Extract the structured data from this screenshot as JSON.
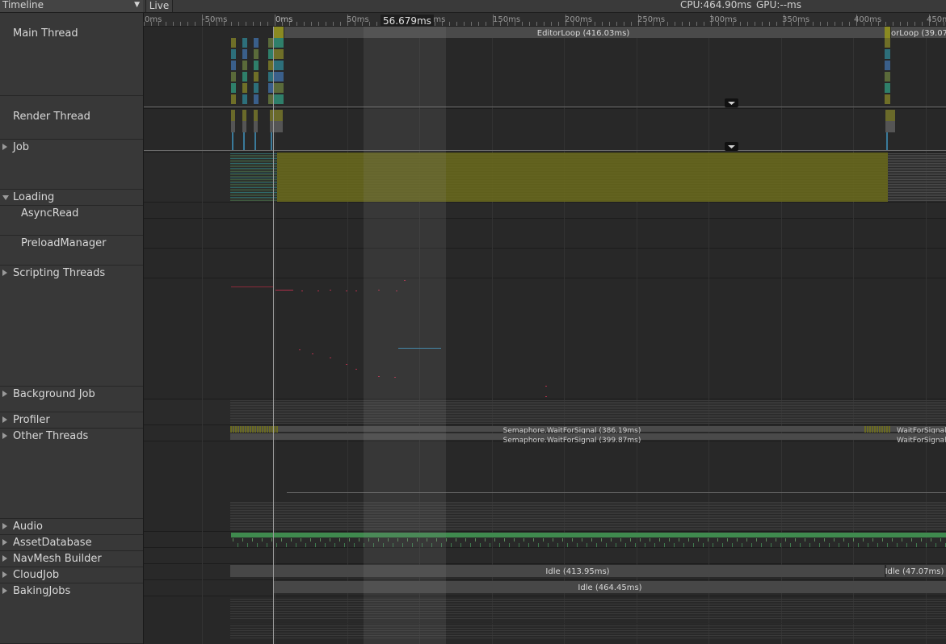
{
  "toolbar": {
    "view_mode": "Timeline",
    "live_label": "Live",
    "cpu_text": "CPU:464.90ms",
    "gpu_text": "GPU:--ms"
  },
  "selection": {
    "duration_label": "56.679ms"
  },
  "ruler": {
    "tick_labels": [
      "0ms",
      "-50ms",
      "0ms",
      "50ms",
      "0ms",
      "150ms",
      "200ms",
      "250ms",
      "300ms",
      "350ms",
      "400ms",
      "450m"
    ]
  },
  "threads": [
    {
      "id": "main",
      "label": "Main Thread",
      "expandable": false,
      "expanded": true
    },
    {
      "id": "render",
      "label": "Render Thread",
      "expandable": false,
      "expanded": true
    },
    {
      "id": "job",
      "label": "Job",
      "expandable": true,
      "expanded": false
    },
    {
      "id": "loading",
      "label": "Loading",
      "expandable": true,
      "expanded": true
    },
    {
      "id": "asyncread",
      "label": "AsyncRead",
      "expandable": false,
      "expanded": false,
      "child": true
    },
    {
      "id": "preload",
      "label": "PreloadManager",
      "expandable": false,
      "expanded": false,
      "child": true
    },
    {
      "id": "scripting",
      "label": "Scripting Threads",
      "expandable": true,
      "expanded": false
    },
    {
      "id": "bgjob",
      "label": "Background Job",
      "expandable": true,
      "expanded": false
    },
    {
      "id": "profiler",
      "label": "Profiler",
      "expandable": true,
      "expanded": false
    },
    {
      "id": "other",
      "label": "Other Threads",
      "expandable": true,
      "expanded": false
    },
    {
      "id": "audio",
      "label": "Audio",
      "expandable": true,
      "expanded": false
    },
    {
      "id": "assetdb",
      "label": "AssetDatabase",
      "expandable": true,
      "expanded": false
    },
    {
      "id": "navmesh",
      "label": "NavMesh Builder",
      "expandable": true,
      "expanded": false
    },
    {
      "id": "cloudjob",
      "label": "CloudJob",
      "expandable": true,
      "expanded": false
    },
    {
      "id": "baking",
      "label": "BakingJobs",
      "expandable": true,
      "expanded": false
    }
  ],
  "samples": {
    "editor_loop": "EditorLoop (416.03ms)",
    "editor_loop_next": "orLoop (39.07",
    "semaphore_1": "Semaphore.WaitForSignal (386.19ms)",
    "semaphore_1_next": "WaitForSignal",
    "semaphore_2": "Semaphore.WaitForSignal (399.87ms)",
    "semaphore_2_next": "WaitForSignal",
    "navmesh_idle": "Idle (413.95ms)",
    "navmesh_idle_next": "Idle (47.07ms)",
    "cloud_idle": "Idle (464.45ms)"
  },
  "colors": {
    "background": "#262626",
    "track_alt": "#2c2c2c",
    "sample_bar": "#4b4b4b",
    "job_yellow": "#6e6e1e",
    "audio_green": "#3f8a4e",
    "selection_overlay": "#5a5a5a"
  }
}
